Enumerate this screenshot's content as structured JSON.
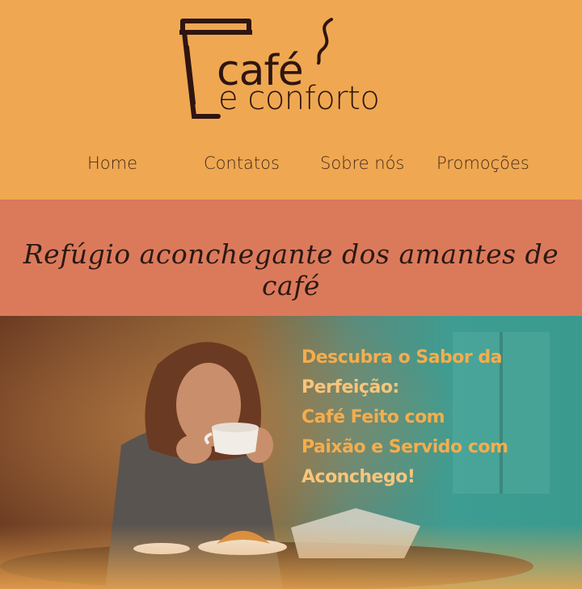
{
  "header": {
    "logo_line1": "café",
    "logo_line2": "e conforto"
  },
  "nav": {
    "items": [
      "Home",
      "Contatos",
      "Sobre nós",
      "Promoções"
    ]
  },
  "tagline": "Refúgio aconchegante dos amantes de café",
  "hero": {
    "line1": "Descubra o Sabor da",
    "line2": "Perfeição:",
    "line3": "Café Feito com",
    "line4": "Paixão e Servido com",
    "line5": "Aconchego!"
  },
  "colors": {
    "header_bg": "#efa851",
    "tagline_bg": "#db7a5b",
    "text_dark": "#2f1511"
  }
}
